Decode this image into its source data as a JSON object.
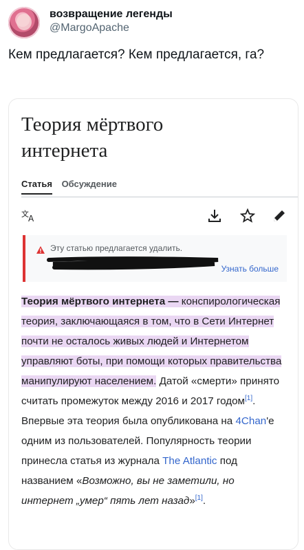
{
  "tweet": {
    "display_name": "возвращение легенды",
    "handle": "@MargoApache",
    "text": "Кем предлагается? Кем предлагается, га?"
  },
  "wiki": {
    "title_line1": "Теория мёртвого",
    "title_line2": "интернета",
    "tabs": [
      {
        "label": "Статья"
      },
      {
        "label": "Обсуждение"
      }
    ],
    "toolbar": {
      "language_icon": "language-translate-icon",
      "download_icon": "download-icon",
      "star_icon": "star-watch-icon",
      "edit_icon": "pencil-edit-icon"
    },
    "notice": {
      "text": "Эту статью предлагается удалить.",
      "link": "Узнать больше",
      "icon": "warning-triangle-icon",
      "accent": "#d33333"
    },
    "article": {
      "bold_term": "Теория мёртвого интернета",
      "dash": " —",
      "p_highlighted": " конспирологическая теория, заключающаяся в том, что в Сети Интернет почти не осталось живых людей и Интернетом управляют боты, при помощи которых правительства манипулируют населением.",
      "p2": " Датой «смерти» принято считать промежуток между 2016 и 2017 годом",
      "ref1": "[1]",
      "p3": ". Впервые эта теория была опубликована на ",
      "link_4chan": "4Chan",
      "p4": "'е одним из пользователей. Популярность теории принесла статья из журнала ",
      "link_atlantic": "The Atlantic",
      "p5": " под названием «",
      "italic_title": "Возможно, вы не заметили, но интернет „умер“ пять лет назад",
      "p6": "»",
      "ref2": "[1]",
      "p7": "."
    },
    "colors": {
      "highlight": "#ead7f3",
      "link": "#3366cc",
      "text": "#202122"
    }
  }
}
